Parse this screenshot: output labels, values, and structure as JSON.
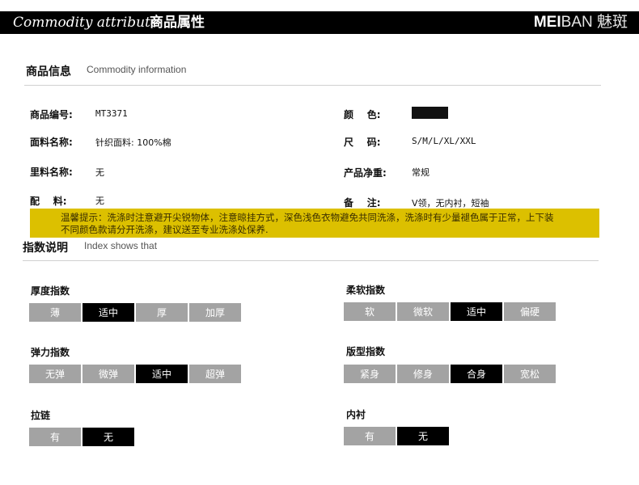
{
  "banner": {
    "en": "Commodity attribute",
    "zh": "商品属性",
    "brand_a": "MEI",
    "brand_b": "BAN 魅斑"
  },
  "info": {
    "title": "商品信息",
    "subtitle": "Commodity information"
  },
  "rows": {
    "code_label": "商品编号:",
    "code_value": "MT3371",
    "color_label": "颜    色:",
    "fabric_label": "面料名称:",
    "fabric_value": "针织面料: 100%棉",
    "size_label": "尺    码:",
    "size_value": "S/M/L/XL/XXL",
    "lining_label": "里料名称:",
    "lining_value": "无",
    "weight_label": "产品净重:",
    "weight_value": "常规",
    "acc_label": "配    料:",
    "acc_value": "无",
    "note_label": "备    注:",
    "note_value": "V领，无内衬，短袖"
  },
  "notice": {
    "line1": "温馨提示：洗涤时注意避开尖锐物体，注意晾挂方式，深色浅色衣物避免共同洗涤，洗涤时有少量褪色属于正常，上下装",
    "line2": "不同颜色款请分开洗涤，建议送至专业洗涤处保养."
  },
  "index": {
    "title": "指数说明",
    "subtitle": "Index shows that"
  },
  "groups": {
    "thickness": {
      "title": "厚度指数",
      "options": [
        "薄",
        "适中",
        "厚",
        "加厚"
      ],
      "selected": 1
    },
    "softness": {
      "title": "柔软指数",
      "options": [
        "软",
        "微软",
        "适中",
        "偏硬"
      ],
      "selected": 2
    },
    "elasticity": {
      "title": "弹力指数",
      "options": [
        "无弹",
        "微弹",
        "适中",
        "超弹"
      ],
      "selected": 2
    },
    "fit": {
      "title": "版型指数",
      "options": [
        "紧身",
        "修身",
        "合身",
        "宽松"
      ],
      "selected": 2
    },
    "zipper": {
      "title": "拉链",
      "options": [
        "有",
        "无"
      ],
      "selected": 1
    },
    "inner": {
      "title": "内衬",
      "options": [
        "有",
        "无"
      ],
      "selected": 1
    }
  }
}
